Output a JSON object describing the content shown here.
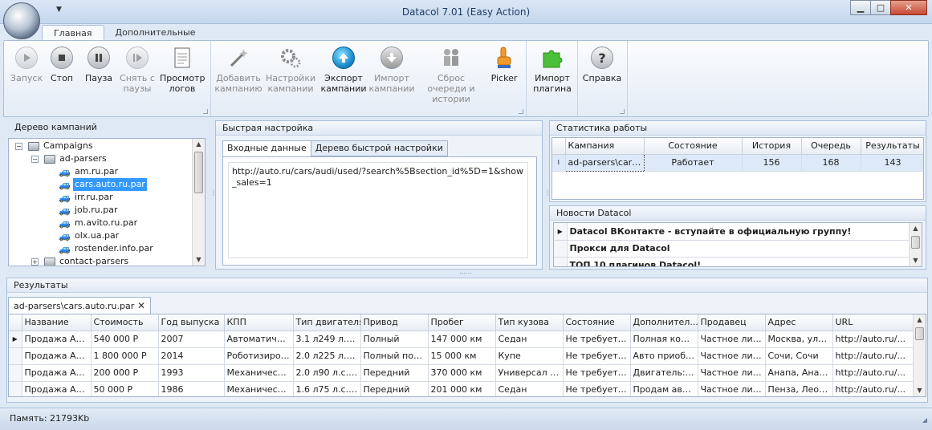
{
  "window": {
    "title": "Datacol 7.01 (Easy Action)",
    "minimize": "▁",
    "maximize": "□",
    "close": "✕",
    "qat": "▼"
  },
  "tabs": [
    "Главная",
    "Дополнительные"
  ],
  "ribbon": {
    "start": "Запуск",
    "stop": "Стоп",
    "pause": "Пауза",
    "unpause": "Снять с паузы",
    "logs": "Просмотр логов",
    "add_campaign": "Добавить кампанию",
    "campaign_settings": "Настройки кампании",
    "export": "Экспорт кампании",
    "import": "Импорт кампании",
    "reset_queue": "Сброс очереди и истории",
    "picker": "Picker",
    "import_plugin": "Импорт плагина",
    "help": "Справка"
  },
  "tree_panel": {
    "title": "Дерево кампаний",
    "root": "Campaigns",
    "group1": "ad-parsers",
    "items": [
      "am.ru.par",
      "cars.auto.ru.par",
      "irr.ru.par",
      "job.ru.par",
      "m.avito.ru.par",
      "olx.ua.par",
      "rostender.info.par"
    ],
    "group2": "contact-parsers"
  },
  "quick_panel": {
    "title": "Быстрая настройка",
    "tab1": "Входные данные",
    "tab2": "Дерево быстрой настройки",
    "input_text": "http://auto.ru/cars/audi/used/?search%5Bsection_id%5D=1&show_sales=1"
  },
  "stats_panel": {
    "title": "Статистика работы",
    "columns": [
      "Кампания",
      "Состояние",
      "История",
      "Очередь",
      "Результаты"
    ],
    "row": {
      "campaign": "ad-parsers\\cars....",
      "state": "Работает",
      "history": "156",
      "queue": "168",
      "results": "143"
    },
    "cursor": "I"
  },
  "news_panel": {
    "title": "Новости Datacol",
    "items": [
      "Datacol ВКонтакте - вступайте в официальную группу!",
      "Прокси для Datacol",
      "ТОП 10 плагинов Datacol!"
    ]
  },
  "results_panel": {
    "title": "Результаты",
    "tab": "ad-parsers\\cars.auto.ru.par",
    "tab_close": "✕",
    "columns": [
      "Название",
      "Стоимость",
      "Год выпуска",
      "КПП",
      "Тип двигателя",
      "Привод",
      "Пробег",
      "Тип кузова",
      "Состояние",
      "Дополнител...",
      "Продавец",
      "Адрес",
      "URL"
    ],
    "rows": [
      [
        "Продажа Au...",
        "540 000 Р",
        "2007",
        "Автоматичес...",
        "3.1 л249 л.с....",
        "Полный",
        "147 000 км",
        "Седан",
        "Не требует ...",
        "Полная комп...",
        "Частное лиц...",
        "Москва, ули...",
        "http://auto.ru/..."
      ],
      [
        "Продажа Au...",
        "1 800 000 Р",
        "2014",
        "Роботизиров...",
        "2.0 л225 л.с....",
        "Полный пост...",
        "15 000 км",
        "Купе",
        "Не требует ...",
        "Авто приобр...",
        "Частное лиц...",
        "Сочи, Сочи",
        "http://auto.ru/..."
      ],
      [
        "Продажа Au...",
        "200 000 Р",
        "1993",
        "Механическая",
        "2.0 л90 л.с.б...",
        "Передний",
        "370 000 км",
        "Универсал 5 ...",
        "Не требует ...",
        "Двигатель: ...",
        "Частное лиц...",
        "Анапа, Анапа",
        "http://auto.ru/..."
      ],
      [
        "Продажа Au...",
        "50 000 Р",
        "1986",
        "Механическая",
        "1.6 л75 л.с.б...",
        "Передний",
        "201 000 км",
        "Седан",
        "Не требует ...",
        "Продам авто...",
        "Частное лиц...",
        "Пенза, Леон...",
        "http://auto.ru/..."
      ]
    ]
  },
  "status": {
    "memory": "Память: 21793Kb"
  }
}
